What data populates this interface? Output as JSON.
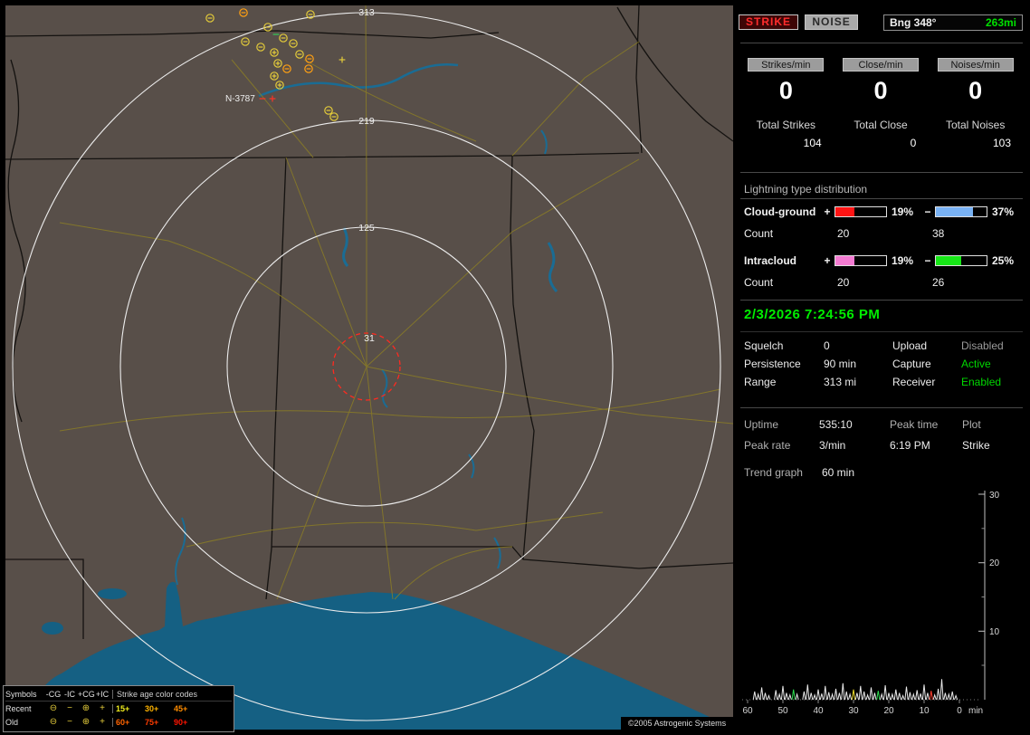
{
  "app": {
    "copyright": "©2005 Astrogenic Systems"
  },
  "indicators": {
    "strike": "STRIKE",
    "noise": "NOISE",
    "bearing": "Bng 348°",
    "distance": "263mi"
  },
  "counters": {
    "columns": [
      {
        "badge": "Strikes/min",
        "rate": "0",
        "total_label": "Total Strikes",
        "total": "104"
      },
      {
        "badge": "Close/min",
        "rate": "0",
        "total_label": "Total Close",
        "total": "0"
      },
      {
        "badge": "Noises/min",
        "rate": "0",
        "total_label": "Total Noises",
        "total": "103"
      }
    ]
  },
  "distribution": {
    "title": "Lightning type distribution",
    "rows": [
      {
        "label": "Cloud-ground",
        "plus_sign": "+",
        "minus_sign": "−",
        "pos_pct": "19%",
        "neg_pct": "37%",
        "pos_value": 19,
        "neg_value": 37,
        "pos_color": "#ff1414",
        "neg_color": "#79b2f4",
        "count_label": "Count",
        "pos_count": "20",
        "neg_count": "38"
      },
      {
        "label": "Intracloud",
        "plus_sign": "+",
        "minus_sign": "−",
        "pos_pct": "19%",
        "neg_pct": "25%",
        "pos_value": 19,
        "neg_value": 25,
        "pos_color": "#f47bd2",
        "neg_color": "#17e617",
        "count_label": "Count",
        "pos_count": "20",
        "neg_count": "26"
      }
    ]
  },
  "status": {
    "datetime": "2/3/2026 7:24:56 PM",
    "settings": [
      {
        "label1": "Squelch",
        "value1": "0",
        "label2": "Upload",
        "value2": "Disabled"
      },
      {
        "label1": "Persistence",
        "value1": "90 min",
        "label2": "Capture",
        "value2": "Active"
      },
      {
        "label1": "Range",
        "value1": "313 mi",
        "label2": "Receiver",
        "value2": "Enabled"
      }
    ]
  },
  "stats": {
    "uptime_label": "Uptime",
    "uptime_value": "535:10",
    "peak_time_label": "Peak time",
    "plot_label": "Plot",
    "peak_rate_label": "Peak rate",
    "peak_rate_value": "3/min",
    "peak_time_value": "6:19 PM",
    "plot_value": "Strike",
    "trend_label": "Trend graph",
    "trend_window": "60 min"
  },
  "chart_data": {
    "type": "bar",
    "title": "Trend graph - strikes per minute, last 60 minutes",
    "xlabel": "min",
    "ylabel": "",
    "ylim": [
      0,
      30
    ],
    "x_ticks": [
      "60",
      "50",
      "40",
      "30",
      "20",
      "10",
      "0"
    ],
    "x_unit": "min",
    "y_ticks": [
      "10",
      "20",
      "30"
    ],
    "colors": {
      "w": "#e8e8e8",
      "g": "#2edc50",
      "y": "#e8d82a",
      "r": "#ff4030"
    },
    "points": [
      [
        58,
        1.2,
        "w"
      ],
      [
        57,
        0.8,
        "w"
      ],
      [
        56,
        1.8,
        "w"
      ],
      [
        55,
        1,
        "w"
      ],
      [
        54,
        0.6,
        "w"
      ],
      [
        52,
        1.4,
        "w"
      ],
      [
        51,
        0.8,
        "w"
      ],
      [
        50,
        2,
        "w"
      ],
      [
        49,
        1,
        "w"
      ],
      [
        48,
        0.7,
        "w"
      ],
      [
        47,
        1.5,
        "g"
      ],
      [
        46,
        0.8,
        "w"
      ],
      [
        44,
        1.2,
        "w"
      ],
      [
        43,
        2.2,
        "w"
      ],
      [
        42,
        1,
        "w"
      ],
      [
        41,
        0.7,
        "w"
      ],
      [
        40,
        1.5,
        "w"
      ],
      [
        39,
        0.9,
        "w"
      ],
      [
        38,
        2,
        "w"
      ],
      [
        37,
        1.1,
        "w"
      ],
      [
        36,
        0.8,
        "w"
      ],
      [
        35,
        1.6,
        "w"
      ],
      [
        34,
        1,
        "w"
      ],
      [
        33,
        2.4,
        "w"
      ],
      [
        32,
        1.2,
        "w"
      ],
      [
        31,
        0.8,
        "w"
      ],
      [
        30,
        1.5,
        "y"
      ],
      [
        29,
        1,
        "w"
      ],
      [
        28,
        2,
        "w"
      ],
      [
        27,
        1.2,
        "w"
      ],
      [
        26,
        0.7,
        "w"
      ],
      [
        25,
        1.8,
        "w"
      ],
      [
        24,
        1,
        "w"
      ],
      [
        23,
        1.3,
        "g"
      ],
      [
        22,
        0.8,
        "w"
      ],
      [
        21,
        2.1,
        "w"
      ],
      [
        20,
        1,
        "w"
      ],
      [
        19,
        0.8,
        "w"
      ],
      [
        18,
        1.5,
        "w"
      ],
      [
        17,
        1,
        "w"
      ],
      [
        16,
        0.6,
        "w"
      ],
      [
        15,
        1.9,
        "w"
      ],
      [
        14,
        1.1,
        "w"
      ],
      [
        13,
        0.8,
        "w"
      ],
      [
        12,
        1.4,
        "w"
      ],
      [
        11,
        0.9,
        "w"
      ],
      [
        10,
        2.2,
        "w"
      ],
      [
        9,
        1,
        "w"
      ],
      [
        8,
        1.3,
        "r"
      ],
      [
        7,
        0.7,
        "w"
      ],
      [
        6,
        1.6,
        "w"
      ],
      [
        5,
        3,
        "w"
      ],
      [
        4,
        1,
        "w"
      ],
      [
        3,
        0.8,
        "w"
      ],
      [
        2,
        1.2,
        "w"
      ],
      [
        1,
        0.6,
        "w"
      ]
    ]
  },
  "map": {
    "ring_labels": [
      "313",
      "219",
      "125",
      "31"
    ],
    "station_label": "N-3787",
    "strike_colors": {
      "y": "#e2ca3a",
      "o": "#ffa013",
      "g": "#33cc55",
      "r": "#ff3326"
    },
    "strikes": [
      [
        226,
        14,
        "cgm",
        "y"
      ],
      [
        263,
        8,
        "cgm",
        "o"
      ],
      [
        337,
        10,
        "cgm",
        "y"
      ],
      [
        290,
        24,
        "cgm",
        "y"
      ],
      [
        299,
        32,
        "icm",
        "g"
      ],
      [
        307,
        36,
        "cgm",
        "y"
      ],
      [
        318,
        42,
        "cgm",
        "y"
      ],
      [
        325,
        54,
        "cgm",
        "y"
      ],
      [
        336,
        59,
        "cgm",
        "o"
      ],
      [
        265,
        40,
        "cgm",
        "y"
      ],
      [
        282,
        46,
        "cgm",
        "y"
      ],
      [
        297,
        52,
        "cgp",
        "y"
      ],
      [
        301,
        64,
        "cgp",
        "y"
      ],
      [
        311,
        70,
        "cgm",
        "o"
      ],
      [
        335,
        70,
        "cgm",
        "o"
      ],
      [
        372,
        60,
        "icp",
        "y"
      ],
      [
        297,
        78,
        "cgp",
        "y"
      ],
      [
        303,
        88,
        "cgp",
        "y"
      ],
      [
        357,
        116,
        "cgm",
        "y"
      ],
      [
        363,
        123,
        "cgm",
        "y"
      ],
      [
        284,
        103,
        "icm",
        "r"
      ],
      [
        295,
        103,
        "icp",
        "r"
      ]
    ],
    "legend": {
      "col_symbols": "Symbols",
      "col_cg_neg": "-CG",
      "col_ic_neg": "-IC",
      "col_cg_pos": "+CG",
      "col_ic_pos": "+IC",
      "age_title": "Strike age color codes",
      "icons": {
        "cg_neg": "⊖",
        "ic_neg": "−",
        "cg_pos": "⊕",
        "ic_pos": "+"
      },
      "rows": [
        {
          "label": "Recent",
          "ages": [
            {
              "t": "15+",
              "c": "#f2ef1d"
            },
            {
              "t": "30+",
              "c": "#ffb400"
            },
            {
              "t": "45+",
              "c": "#ff8c00"
            }
          ]
        },
        {
          "label": "Old",
          "ages": [
            {
              "t": "60+",
              "c": "#ff6400"
            },
            {
              "t": "75+",
              "c": "#ff3c00"
            },
            {
              "t": "90+",
              "c": "#ff1400"
            }
          ]
        }
      ]
    }
  }
}
